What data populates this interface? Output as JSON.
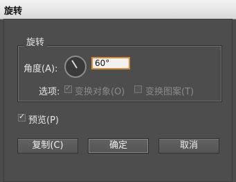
{
  "window": {
    "title": "旋转"
  },
  "group": {
    "title": "旋转"
  },
  "angle": {
    "label": "角度(A):",
    "value": "60°",
    "dial_degrees": 60
  },
  "options": {
    "label": "选项:",
    "transform_objects": {
      "label": "变换对象(O)",
      "checked": true,
      "enabled": false
    },
    "transform_patterns": {
      "label": "变换图案(T)",
      "checked": false,
      "enabled": false
    }
  },
  "preview": {
    "label": "预览(P)",
    "checked": true
  },
  "buttons": {
    "copy": "复制(C)",
    "ok": "确定",
    "cancel": "取消"
  }
}
